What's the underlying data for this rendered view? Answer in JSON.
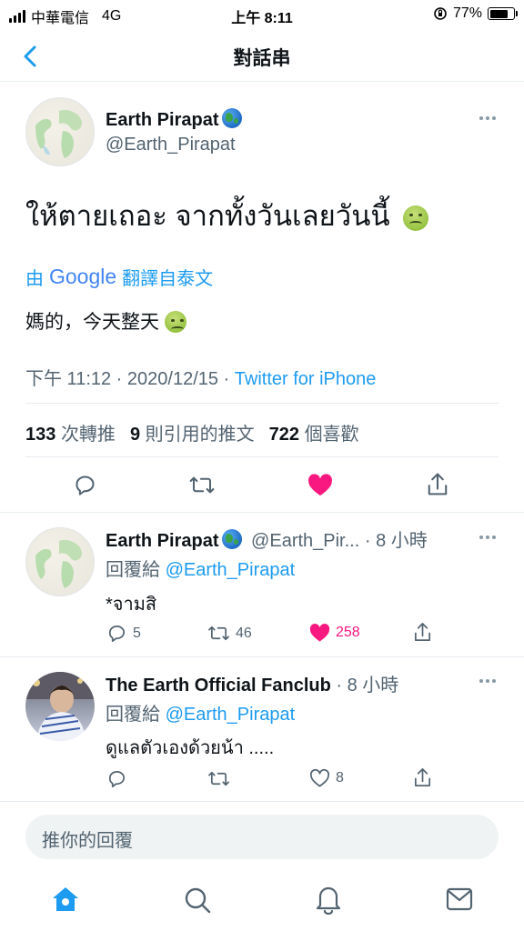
{
  "status_bar": {
    "carrier": "中華電信",
    "network": "4G",
    "time": "上午 8:11",
    "battery_percent": "77%",
    "battery_level": 0.77
  },
  "header": {
    "title": "對話串",
    "back_icon": "chevron-left-icon"
  },
  "main_tweet": {
    "author_name": "Earth Pirapat",
    "author_handle": "@Earth_Pirapat",
    "text": "ให้ตายเถอะ จากทั้งวันเลยวันนี้",
    "translate_prefix": "由",
    "translate_brand": "Google",
    "translate_suffix": "翻譯自泰文",
    "translation": "媽的，今天整天",
    "timestamp": "下午 11:12 · 2020/12/15 · ",
    "source": "Twitter for iPhone",
    "retweets_count": "133",
    "retweets_label": "次轉推",
    "quotes_count": "9",
    "quotes_label": "則引用的推文",
    "likes_count": "722",
    "likes_label": "個喜歡"
  },
  "replies": [
    {
      "author_name": "Earth Pirapat",
      "author_handle": "@Earth_Pir...",
      "time": "· 8 小時",
      "replying_to_label": "回覆給",
      "replying_to_handle": "@Earth_Pirapat",
      "text": "*จามสิ",
      "reply_count": "5",
      "retweet_count": "46",
      "like_count": "258"
    },
    {
      "author_name": "The Earth Official Fanclub",
      "time": "· 8 小時",
      "replying_to_label": "回覆給",
      "replying_to_handle": "@Earth_Pirapat",
      "text": "ดูแลตัวเองด้วยน้า .....",
      "reply_count": "",
      "retweet_count": "",
      "like_count": "8"
    }
  ],
  "reply_box": {
    "placeholder": "推你的回覆"
  },
  "tab_bar": [
    "home-icon",
    "search-icon",
    "notifications-icon",
    "messages-icon"
  ],
  "colors": {
    "accent": "#1d9bf0",
    "like": "#f91880",
    "muted": "#536471"
  }
}
